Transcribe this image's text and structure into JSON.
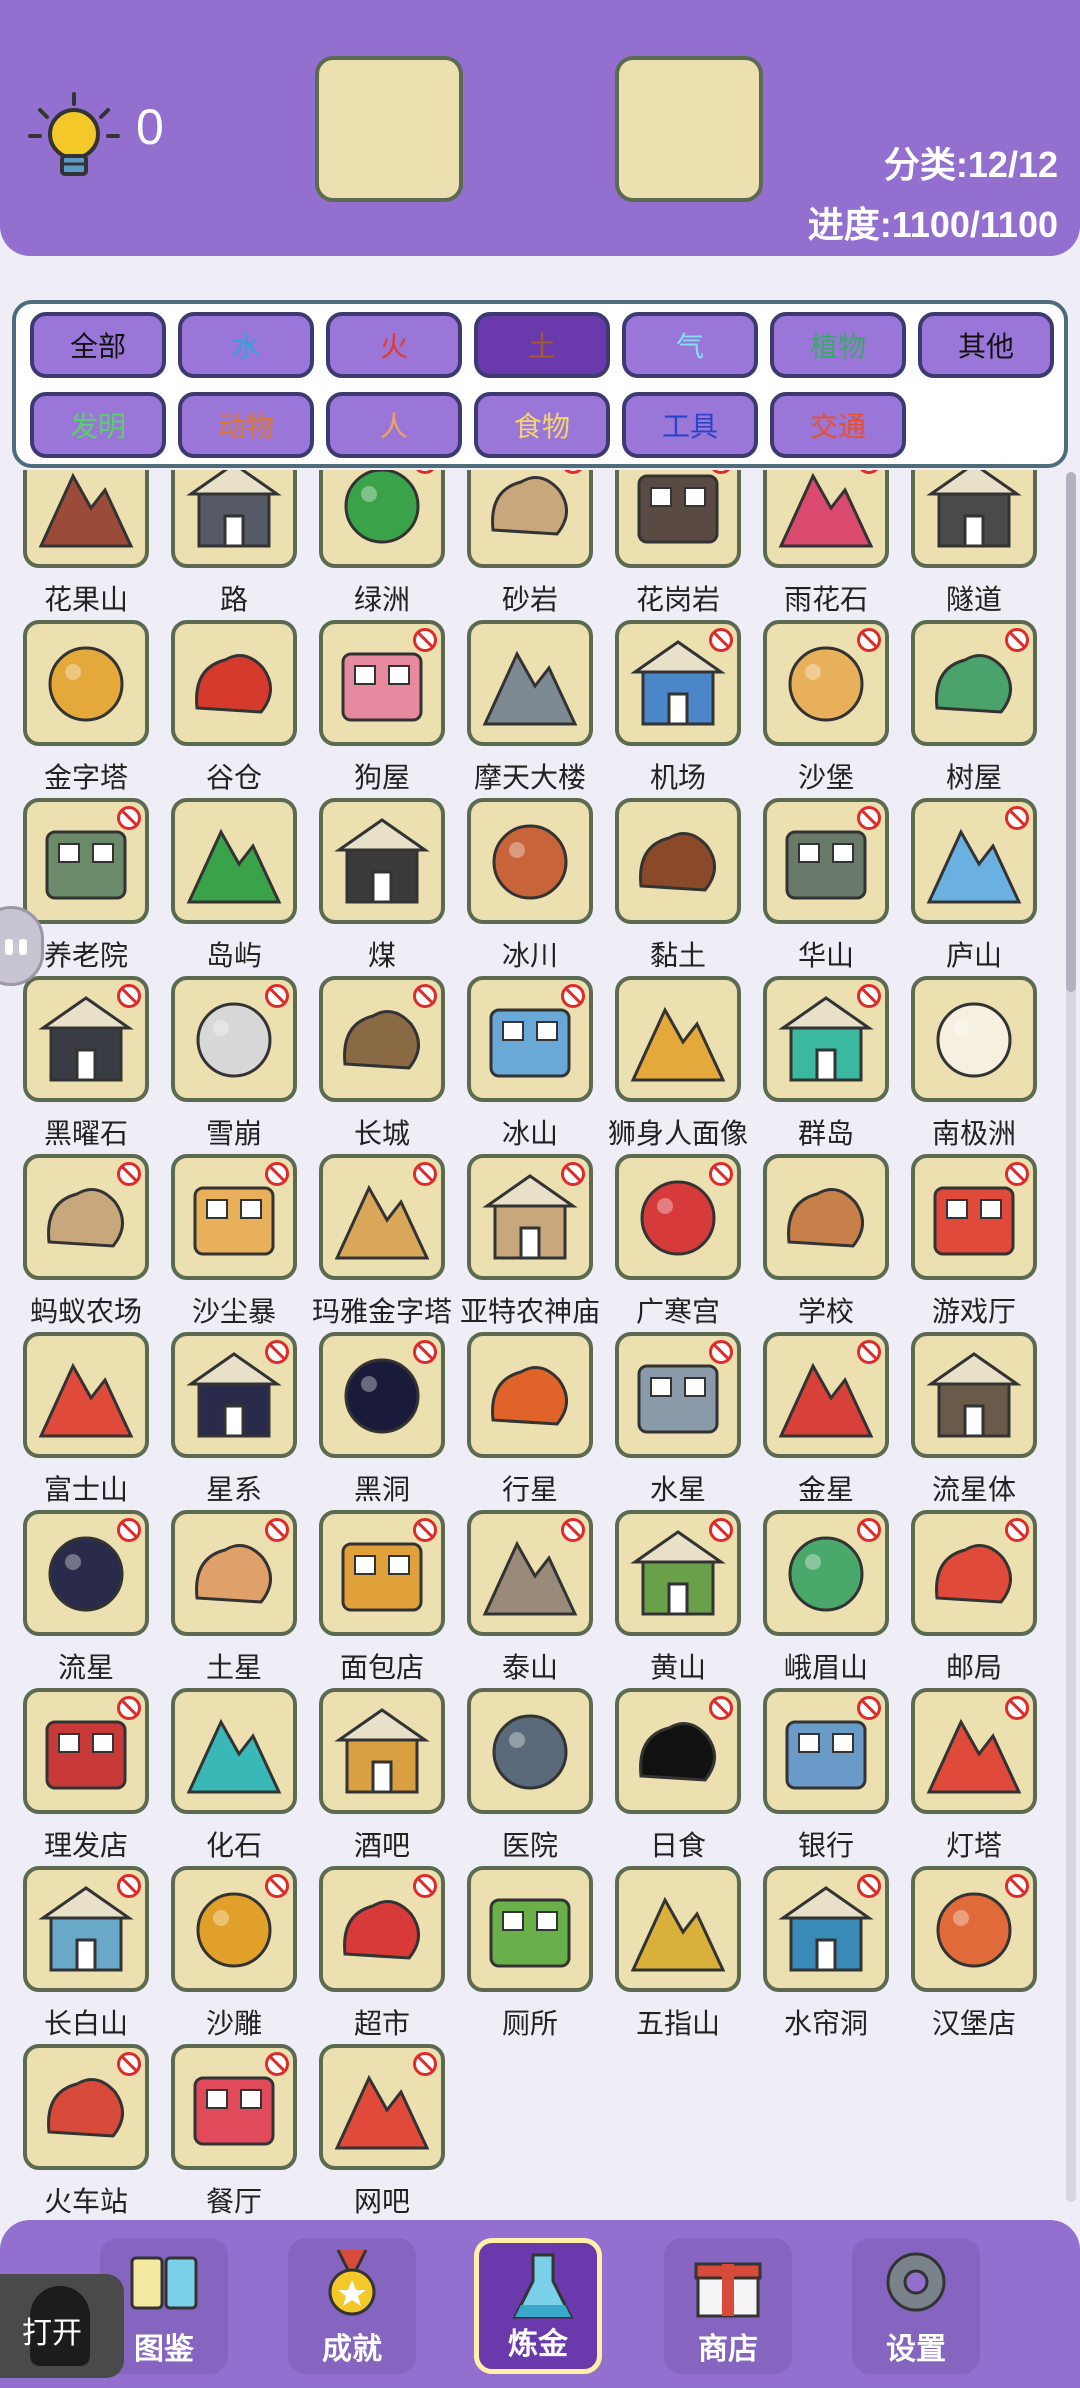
{
  "header": {
    "hint_count": "0",
    "category_stat": "分类:12/12",
    "progress_stat": "进度:1100/1100"
  },
  "filters": [
    {
      "label": "全部",
      "color": "#111111",
      "active": false
    },
    {
      "label": "水",
      "color": "#2aa6d9",
      "active": false
    },
    {
      "label": "火",
      "color": "#e23b2b",
      "active": false
    },
    {
      "label": "土",
      "color": "#a15a2a",
      "active": true
    },
    {
      "label": "气",
      "color": "#7fe0ee",
      "active": false
    },
    {
      "label": "植物",
      "color": "#3aa868",
      "active": false
    },
    {
      "label": "其他",
      "color": "#111111",
      "active": false
    },
    {
      "label": "发明",
      "color": "#58d06a",
      "active": false
    },
    {
      "label": "动物",
      "color": "#e2762b",
      "active": false
    },
    {
      "label": "人",
      "color": "#f0a45a",
      "active": false
    },
    {
      "label": "食物",
      "color": "#f5d46a",
      "active": false
    },
    {
      "label": "工具",
      "color": "#2a44c8",
      "active": false
    },
    {
      "label": "交通",
      "color": "#e8502b",
      "active": false
    }
  ],
  "items": [
    {
      "name": "花果山",
      "icon": "mountain-rock-icon",
      "color": "#9b4b3a",
      "banned": false
    },
    {
      "name": "路",
      "icon": "road-icon",
      "color": "#555a66",
      "banned": false
    },
    {
      "name": "绿洲",
      "icon": "palm-tree-icon",
      "color": "#3aa34a",
      "banned": true
    },
    {
      "name": "砂岩",
      "icon": "sandstone-icon",
      "color": "#c9a77c",
      "banned": true
    },
    {
      "name": "花岗岩",
      "icon": "granite-icon",
      "color": "#5a4a44",
      "banned": true
    },
    {
      "name": "雨花石",
      "icon": "pebbles-icon",
      "color": "#d94a6e",
      "banned": true
    },
    {
      "name": "隧道",
      "icon": "tunnel-icon",
      "color": "#4a4a4a",
      "banned": false
    },
    {
      "name": "金字塔",
      "icon": "pyramid-icon",
      "color": "#e5a93b",
      "banned": false
    },
    {
      "name": "谷仓",
      "icon": "barn-icon",
      "color": "#d63a2c",
      "banned": false
    },
    {
      "name": "狗屋",
      "icon": "doghouse-icon",
      "color": "#e78aa0",
      "banned": true
    },
    {
      "name": "摩天大楼",
      "icon": "skyscraper-icon",
      "color": "#7d8a92",
      "banned": false
    },
    {
      "name": "机场",
      "icon": "airport-icon",
      "color": "#4a86c8",
      "banned": true
    },
    {
      "name": "沙堡",
      "icon": "sandcastle-icon",
      "color": "#e8b05a",
      "banned": true
    },
    {
      "name": "树屋",
      "icon": "treehouse-icon",
      "color": "#4aa36a",
      "banned": true
    },
    {
      "name": "养老院",
      "icon": "nursing-home-icon",
      "color": "#6a8a6a",
      "banned": true
    },
    {
      "name": "岛屿",
      "icon": "island-icon",
      "color": "#3aa34a",
      "banned": false
    },
    {
      "name": "煤",
      "icon": "coal-icon",
      "color": "#3a3a3a",
      "banned": false
    },
    {
      "name": "冰川",
      "icon": "glacier-icon",
      "color": "#c8643a",
      "banned": false
    },
    {
      "name": "黏土",
      "icon": "clay-icon",
      "color": "#8a4a2a",
      "banned": false
    },
    {
      "name": "华山",
      "icon": "huashan-icon",
      "color": "#6a7a6a",
      "banned": true
    },
    {
      "name": "庐山",
      "icon": "lushan-icon",
      "color": "#6ab0e0",
      "banned": true
    },
    {
      "name": "黑曜石",
      "icon": "obsidian-icon",
      "color": "#3a3c44",
      "banned": true
    },
    {
      "name": "雪崩",
      "icon": "avalanche-icon",
      "color": "#d8d8d8",
      "banned": true
    },
    {
      "name": "长城",
      "icon": "great-wall-icon",
      "color": "#8a6a44",
      "banned": true
    },
    {
      "name": "冰山",
      "icon": "iceberg-icon",
      "color": "#6aa8d8",
      "banned": true
    },
    {
      "name": "狮身人面像",
      "icon": "sphinx-icon",
      "color": "#e5a93b",
      "banned": false
    },
    {
      "name": "群岛",
      "icon": "archipelago-icon",
      "color": "#3ab8a0",
      "banned": true
    },
    {
      "name": "南极洲",
      "icon": "antarctica-icon",
      "color": "#f5f0e0",
      "banned": false
    },
    {
      "name": "蚂蚁农场",
      "icon": "ant-farm-icon",
      "color": "#c8a77c",
      "banned": true
    },
    {
      "name": "沙尘暴",
      "icon": "sandstorm-icon",
      "color": "#e8b05a",
      "banned": true
    },
    {
      "name": "玛雅金字塔",
      "icon": "maya-pyramid-icon",
      "color": "#d8a75a",
      "banned": true
    },
    {
      "name": "亚特农神庙",
      "icon": "parthenon-icon",
      "color": "#c8a77c",
      "banned": true
    },
    {
      "name": "广寒宫",
      "icon": "pagoda-icon",
      "color": "#d63a3a",
      "banned": true
    },
    {
      "name": "学校",
      "icon": "school-icon",
      "color": "#c8804a",
      "banned": false
    },
    {
      "name": "游戏厅",
      "icon": "arcade-icon",
      "color": "#e04a3a",
      "banned": true
    },
    {
      "name": "富士山",
      "icon": "fuji-icon",
      "color": "#e04a3a",
      "banned": false
    },
    {
      "name": "星系",
      "icon": "galaxy-icon",
      "color": "#2a2a4a",
      "banned": true
    },
    {
      "name": "黑洞",
      "icon": "black-hole-icon",
      "color": "#1a1a3a",
      "banned": true
    },
    {
      "name": "行星",
      "icon": "planet-icon",
      "color": "#e0642a",
      "banned": false
    },
    {
      "name": "水星",
      "icon": "mercury-icon",
      "color": "#8a9aa8",
      "banned": true
    },
    {
      "name": "金星",
      "icon": "venus-icon",
      "color": "#d8403a",
      "banned": true
    },
    {
      "name": "流星体",
      "icon": "meteoroid-icon",
      "color": "#6a5a4a",
      "banned": false
    },
    {
      "name": "流星",
      "icon": "meteor-icon",
      "color": "#2a2a4a",
      "banned": true
    },
    {
      "name": "土星",
      "icon": "saturn-icon",
      "color": "#e0a06a",
      "banned": true
    },
    {
      "name": "面包店",
      "icon": "bakery-icon",
      "color": "#e0a03a",
      "banned": true
    },
    {
      "name": "泰山",
      "icon": "taishan-icon",
      "color": "#9a8a7a",
      "banned": true
    },
    {
      "name": "黄山",
      "icon": "huangshan-icon",
      "color": "#6aa04a",
      "banned": true
    },
    {
      "name": "峨眉山",
      "icon": "emeishan-icon",
      "color": "#4aa86a",
      "banned": true
    },
    {
      "name": "邮局",
      "icon": "post-office-icon",
      "color": "#e04a3a",
      "banned": true
    },
    {
      "name": "理发店",
      "icon": "barbershop-icon",
      "color": "#c83a3a",
      "banned": true
    },
    {
      "name": "化石",
      "icon": "fossil-icon",
      "color": "#3ab8b8",
      "banned": false
    },
    {
      "name": "酒吧",
      "icon": "bar-icon",
      "color": "#d8a040",
      "banned": false
    },
    {
      "name": "医院",
      "icon": "hospital-icon",
      "color": "#5a6a7a",
      "banned": false
    },
    {
      "name": "日食",
      "icon": "eclipse-icon",
      "color": "#111111",
      "banned": true
    },
    {
      "name": "银行",
      "icon": "bank-icon",
      "color": "#6a9ac8",
      "banned": true
    },
    {
      "name": "灯塔",
      "icon": "lighthouse-icon",
      "color": "#e04a3a",
      "banned": true
    },
    {
      "name": "长白山",
      "icon": "changbaishan-icon",
      "color": "#6aa8c8",
      "banned": true
    },
    {
      "name": "沙雕",
      "icon": "sand-sculpture-icon",
      "color": "#e0a02a",
      "banned": true
    },
    {
      "name": "超市",
      "icon": "supermarket-icon",
      "color": "#d83a3a",
      "banned": true
    },
    {
      "name": "厕所",
      "icon": "toilet-icon",
      "color": "#6ab04a",
      "banned": false
    },
    {
      "name": "五指山",
      "icon": "wuzhishan-icon",
      "color": "#d8b03a",
      "banned": false
    },
    {
      "name": "水帘洞",
      "icon": "waterfall-cave-icon",
      "color": "#3a8ab8",
      "banned": true
    },
    {
      "name": "汉堡店",
      "icon": "burger-shop-icon",
      "color": "#e06a3a",
      "banned": true
    },
    {
      "name": "火车站",
      "icon": "train-station-icon",
      "color": "#d84a3a",
      "banned": true
    },
    {
      "name": "餐厅",
      "icon": "restaurant-icon",
      "color": "#e04a5a",
      "banned": true
    },
    {
      "name": "网吧",
      "icon": "internet-cafe-icon",
      "color": "#e04a3a",
      "banned": true
    }
  ],
  "nav": [
    {
      "label": "图鉴",
      "icon": "book-icon",
      "active": false
    },
    {
      "label": "成就",
      "icon": "medal-icon",
      "active": false
    },
    {
      "label": "炼金",
      "icon": "flask-icon",
      "active": true
    },
    {
      "label": "商店",
      "icon": "gift-icon",
      "active": false
    },
    {
      "label": "设置",
      "icon": "gear-icon",
      "active": false
    }
  ],
  "open_label": "打开"
}
